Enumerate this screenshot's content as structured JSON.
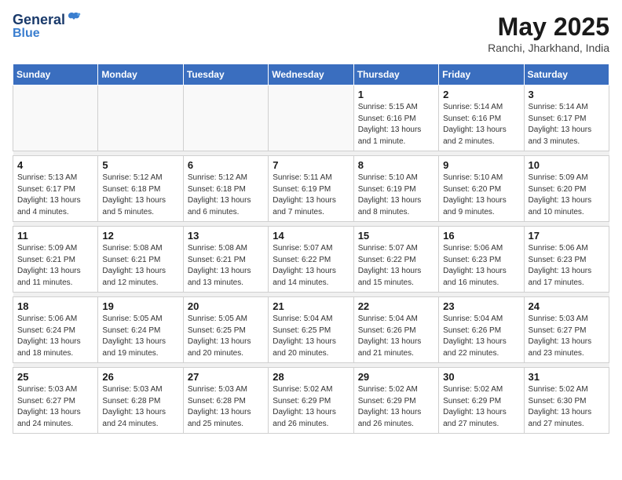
{
  "header": {
    "logo_line1": "General",
    "logo_line2": "Blue",
    "month": "May 2025",
    "location": "Ranchi, Jharkhand, India"
  },
  "weekdays": [
    "Sunday",
    "Monday",
    "Tuesday",
    "Wednesday",
    "Thursday",
    "Friday",
    "Saturday"
  ],
  "weeks": [
    [
      {
        "day": "",
        "detail": ""
      },
      {
        "day": "",
        "detail": ""
      },
      {
        "day": "",
        "detail": ""
      },
      {
        "day": "",
        "detail": ""
      },
      {
        "day": "1",
        "detail": "Sunrise: 5:15 AM\nSunset: 6:16 PM\nDaylight: 13 hours\nand 1 minute."
      },
      {
        "day": "2",
        "detail": "Sunrise: 5:14 AM\nSunset: 6:16 PM\nDaylight: 13 hours\nand 2 minutes."
      },
      {
        "day": "3",
        "detail": "Sunrise: 5:14 AM\nSunset: 6:17 PM\nDaylight: 13 hours\nand 3 minutes."
      }
    ],
    [
      {
        "day": "4",
        "detail": "Sunrise: 5:13 AM\nSunset: 6:17 PM\nDaylight: 13 hours\nand 4 minutes."
      },
      {
        "day": "5",
        "detail": "Sunrise: 5:12 AM\nSunset: 6:18 PM\nDaylight: 13 hours\nand 5 minutes."
      },
      {
        "day": "6",
        "detail": "Sunrise: 5:12 AM\nSunset: 6:18 PM\nDaylight: 13 hours\nand 6 minutes."
      },
      {
        "day": "7",
        "detail": "Sunrise: 5:11 AM\nSunset: 6:19 PM\nDaylight: 13 hours\nand 7 minutes."
      },
      {
        "day": "8",
        "detail": "Sunrise: 5:10 AM\nSunset: 6:19 PM\nDaylight: 13 hours\nand 8 minutes."
      },
      {
        "day": "9",
        "detail": "Sunrise: 5:10 AM\nSunset: 6:20 PM\nDaylight: 13 hours\nand 9 minutes."
      },
      {
        "day": "10",
        "detail": "Sunrise: 5:09 AM\nSunset: 6:20 PM\nDaylight: 13 hours\nand 10 minutes."
      }
    ],
    [
      {
        "day": "11",
        "detail": "Sunrise: 5:09 AM\nSunset: 6:21 PM\nDaylight: 13 hours\nand 11 minutes."
      },
      {
        "day": "12",
        "detail": "Sunrise: 5:08 AM\nSunset: 6:21 PM\nDaylight: 13 hours\nand 12 minutes."
      },
      {
        "day": "13",
        "detail": "Sunrise: 5:08 AM\nSunset: 6:21 PM\nDaylight: 13 hours\nand 13 minutes."
      },
      {
        "day": "14",
        "detail": "Sunrise: 5:07 AM\nSunset: 6:22 PM\nDaylight: 13 hours\nand 14 minutes."
      },
      {
        "day": "15",
        "detail": "Sunrise: 5:07 AM\nSunset: 6:22 PM\nDaylight: 13 hours\nand 15 minutes."
      },
      {
        "day": "16",
        "detail": "Sunrise: 5:06 AM\nSunset: 6:23 PM\nDaylight: 13 hours\nand 16 minutes."
      },
      {
        "day": "17",
        "detail": "Sunrise: 5:06 AM\nSunset: 6:23 PM\nDaylight: 13 hours\nand 17 minutes."
      }
    ],
    [
      {
        "day": "18",
        "detail": "Sunrise: 5:06 AM\nSunset: 6:24 PM\nDaylight: 13 hours\nand 18 minutes."
      },
      {
        "day": "19",
        "detail": "Sunrise: 5:05 AM\nSunset: 6:24 PM\nDaylight: 13 hours\nand 19 minutes."
      },
      {
        "day": "20",
        "detail": "Sunrise: 5:05 AM\nSunset: 6:25 PM\nDaylight: 13 hours\nand 20 minutes."
      },
      {
        "day": "21",
        "detail": "Sunrise: 5:04 AM\nSunset: 6:25 PM\nDaylight: 13 hours\nand 20 minutes."
      },
      {
        "day": "22",
        "detail": "Sunrise: 5:04 AM\nSunset: 6:26 PM\nDaylight: 13 hours\nand 21 minutes."
      },
      {
        "day": "23",
        "detail": "Sunrise: 5:04 AM\nSunset: 6:26 PM\nDaylight: 13 hours\nand 22 minutes."
      },
      {
        "day": "24",
        "detail": "Sunrise: 5:03 AM\nSunset: 6:27 PM\nDaylight: 13 hours\nand 23 minutes."
      }
    ],
    [
      {
        "day": "25",
        "detail": "Sunrise: 5:03 AM\nSunset: 6:27 PM\nDaylight: 13 hours\nand 24 minutes."
      },
      {
        "day": "26",
        "detail": "Sunrise: 5:03 AM\nSunset: 6:28 PM\nDaylight: 13 hours\nand 24 minutes."
      },
      {
        "day": "27",
        "detail": "Sunrise: 5:03 AM\nSunset: 6:28 PM\nDaylight: 13 hours\nand 25 minutes."
      },
      {
        "day": "28",
        "detail": "Sunrise: 5:02 AM\nSunset: 6:29 PM\nDaylight: 13 hours\nand 26 minutes."
      },
      {
        "day": "29",
        "detail": "Sunrise: 5:02 AM\nSunset: 6:29 PM\nDaylight: 13 hours\nand 26 minutes."
      },
      {
        "day": "30",
        "detail": "Sunrise: 5:02 AM\nSunset: 6:29 PM\nDaylight: 13 hours\nand 27 minutes."
      },
      {
        "day": "31",
        "detail": "Sunrise: 5:02 AM\nSunset: 6:30 PM\nDaylight: 13 hours\nand 27 minutes."
      }
    ]
  ]
}
